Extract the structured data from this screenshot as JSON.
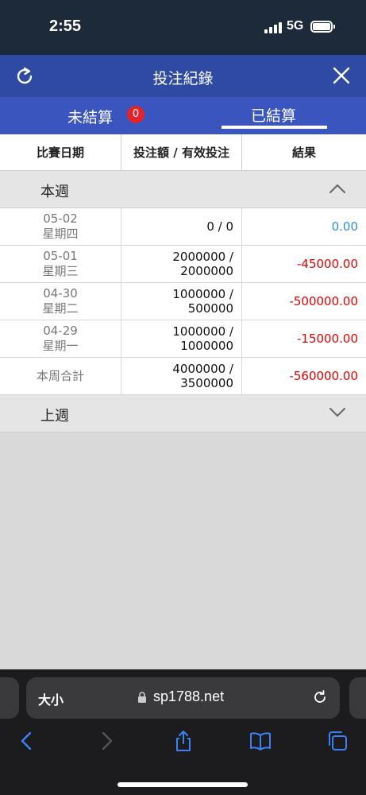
{
  "status_bar": {
    "time": "2:55",
    "network": "5G"
  },
  "header": {
    "title": "投注紀錄"
  },
  "tabs": {
    "unsettled_label": "未結算",
    "unsettled_count": "0",
    "settled_label": "已結算"
  },
  "table_header": {
    "date": "比賽日期",
    "amount": "投注額 / 有效投注",
    "result": "結果"
  },
  "this_week": {
    "title": "本週",
    "rows": [
      {
        "date": "05-02",
        "weekday": "星期四",
        "amount_line1": "0 / 0",
        "amount_line2": "",
        "result": "0.00"
      },
      {
        "date": "05-01",
        "weekday": "星期三",
        "amount_line1": "2000000 /",
        "amount_line2": "2000000",
        "result": "-45000.00"
      },
      {
        "date": "04-30",
        "weekday": "星期二",
        "amount_line1": "1000000 /",
        "amount_line2": "500000",
        "result": "-500000.00"
      },
      {
        "date": "04-29",
        "weekday": "星期一",
        "amount_line1": "1000000 /",
        "amount_line2": "1000000",
        "result": "-15000.00"
      }
    ],
    "total": {
      "label": "本周合計",
      "amount_line1": "4000000 /",
      "amount_line2": "3500000",
      "result": "-560000.00"
    }
  },
  "last_week": {
    "title": "上週"
  },
  "browser": {
    "text_size_label": "大小",
    "url": "sp1788.net"
  },
  "colors": {
    "header": "#2f4aa3",
    "tabs": "#3a55bd",
    "negative": "#e30000",
    "zero": "#2d8ce3"
  }
}
